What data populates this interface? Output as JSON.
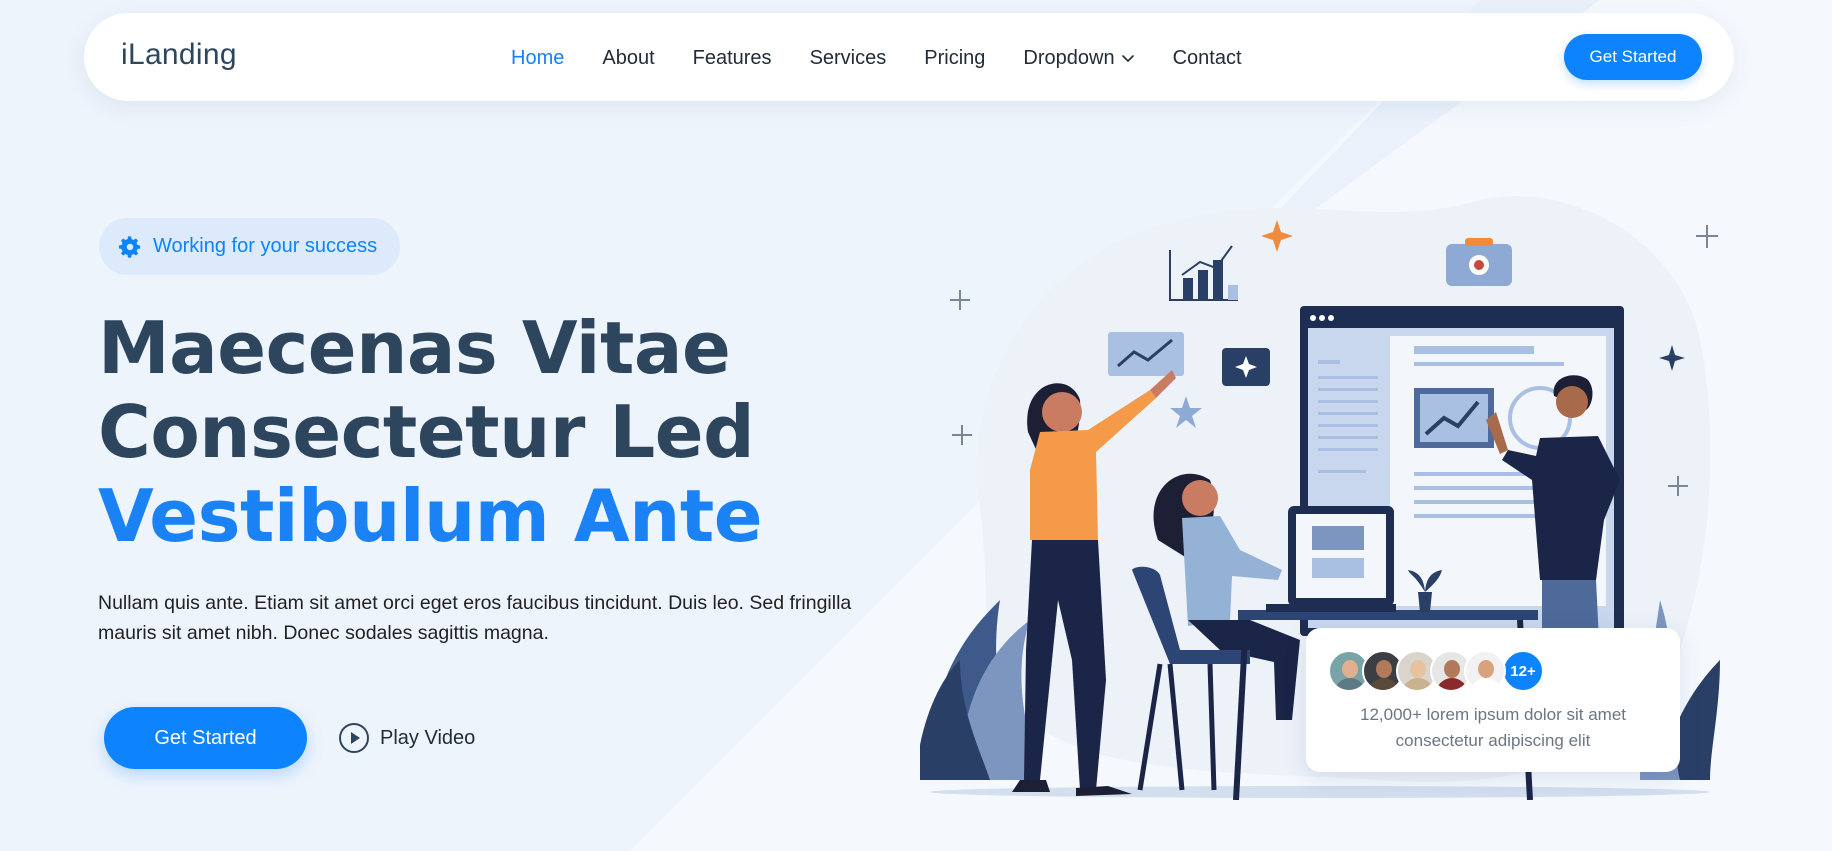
{
  "brand": {
    "logo_text": "iLanding",
    "accent_color": "#0d83fd",
    "heading_color": "#2d465e"
  },
  "nav": {
    "items": [
      {
        "label": "Home",
        "active": true
      },
      {
        "label": "About"
      },
      {
        "label": "Features"
      },
      {
        "label": "Services"
      },
      {
        "label": "Pricing"
      },
      {
        "label": "Dropdown",
        "icon": "chevron-down-icon"
      },
      {
        "label": "Contact"
      }
    ],
    "cta_label": "Get Started"
  },
  "hero": {
    "badge": {
      "icon": "gear-icon",
      "text": "Working for your success"
    },
    "title_line1": "Maecenas Vitae",
    "title_line2": "Consectetur Led",
    "title_line3": "Vestibulum Ante",
    "description": "Nullam quis ante. Etiam sit amet orci eget eros faucibus tincidunt. Duis leo. Sed fringilla mauris sit amet nibh. Donec sodales sagittis magna.",
    "cta_label": "Get Started",
    "play_label": "Play Video",
    "play_icon": "play-circle-icon"
  },
  "stats_card": {
    "more_badge": "12+",
    "text": "12,000+ lorem ipsum dolor sit amet consectetur adipiscing elit"
  }
}
